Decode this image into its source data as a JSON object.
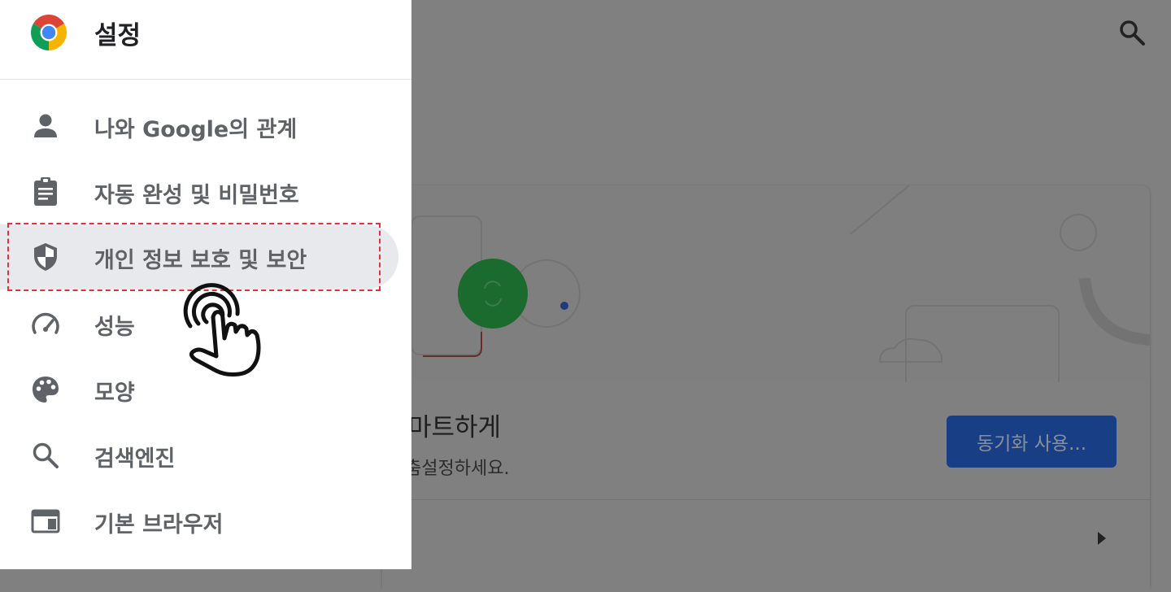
{
  "drawer": {
    "title": "설정",
    "items": [
      {
        "label": "나와 Google의 관계",
        "icon": "person-icon"
      },
      {
        "label": "자동 완성 및 비밀번호",
        "icon": "clipboard-icon"
      },
      {
        "label": "개인 정보 보호 및 보안",
        "icon": "shield-icon",
        "selected": true
      },
      {
        "label": "성능",
        "icon": "speedometer-icon"
      },
      {
        "label": "모양",
        "icon": "palette-icon"
      },
      {
        "label": "검색엔진",
        "icon": "search-icon"
      },
      {
        "label": "기본 브라우저",
        "icon": "browser-window-icon"
      }
    ]
  },
  "background": {
    "title_partial": "마트하게",
    "subtitle_partial": "춤설정하세요.",
    "sync_button_label": "동기화 사용..."
  },
  "colors": {
    "highlight_border": "#e0323c",
    "selected_bg": "#e8e9ec",
    "icon_gray": "#5f6368",
    "sync_button": "#183f85",
    "sync_circle": "#1b6a2e"
  }
}
